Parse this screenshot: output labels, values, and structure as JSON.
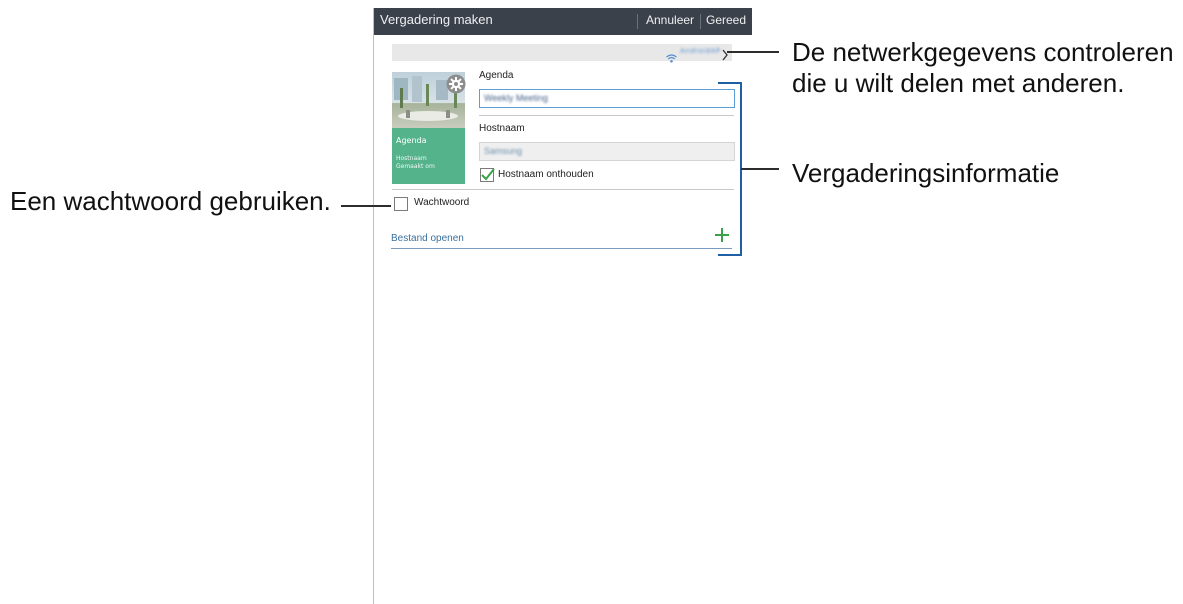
{
  "header": {
    "title": "Vergadering maken",
    "cancel_label": "Annuleer",
    "done_label": "Gereed"
  },
  "network": {
    "ssid": "AndroidAP",
    "icon": "wifi-icon",
    "chevron_icon": "chevron-right-icon"
  },
  "thumbnail": {
    "agenda": "Agenda",
    "host": "Hostnaam",
    "created": "Gemaakt om",
    "settings_icon": "gear-icon"
  },
  "form": {
    "agenda_label": "Agenda",
    "agenda_value": "Weekly Meeting",
    "host_label": "Hostnaam",
    "host_value": "Samsung",
    "remember_host_label": "Hostnaam onthouden",
    "remember_host_checked": true,
    "password_label": "Wachtwoord",
    "password_checked": false,
    "open_file_label": "Bestand openen",
    "add_icon": "plus-icon"
  },
  "callouts": {
    "network_line1": "De netwerkgegevens controleren",
    "network_line2": "die u wilt delen met anderen.",
    "meeting_info": "Vergaderingsinformatie",
    "password": "Een wachtwoord gebruiken."
  },
  "colors": {
    "actionbar": "#3b414a",
    "accent_green": "#55b38c",
    "check_green": "#3aa14a",
    "bracket_blue": "#1f5fa3"
  }
}
